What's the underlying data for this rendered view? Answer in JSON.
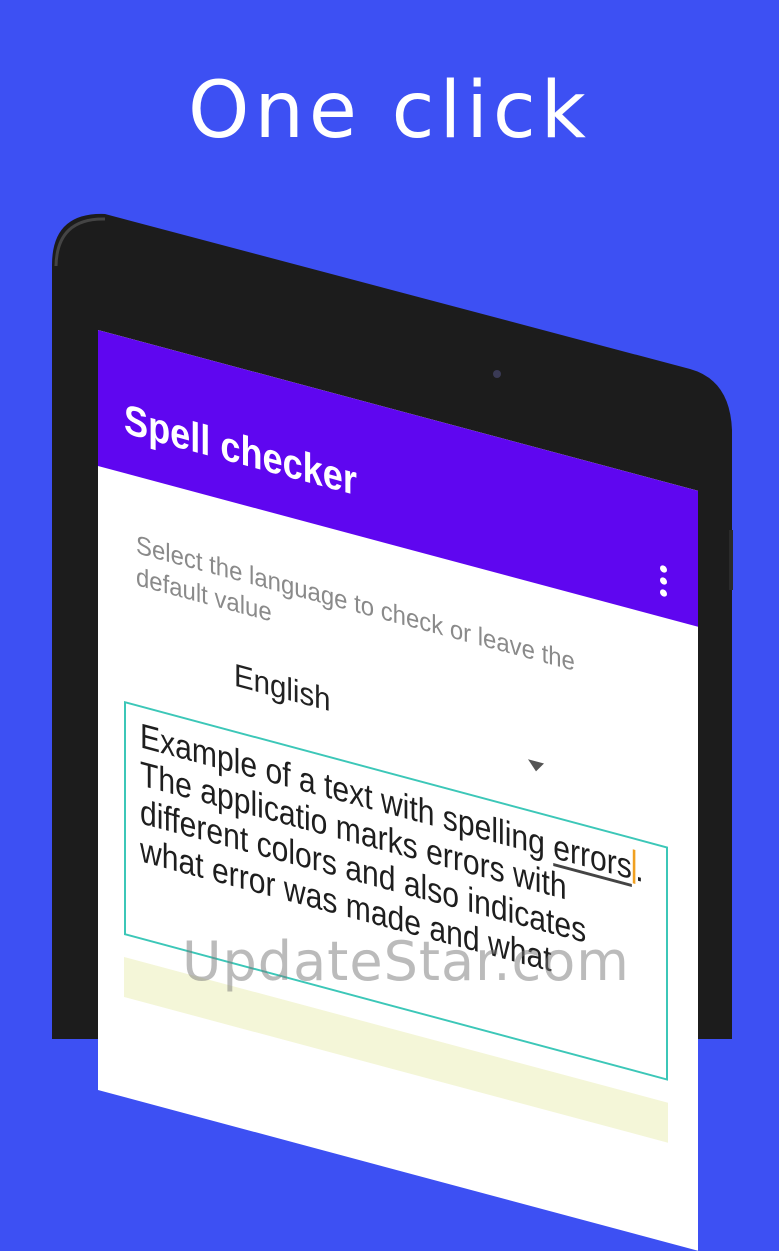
{
  "promo": {
    "headline": "One click"
  },
  "app": {
    "title": "Spell checker",
    "menu_icon": "more-vert-icon",
    "accent_color": "#5f06f0",
    "background_color": "#3d50f3"
  },
  "language": {
    "hint": "Select the language to check or leave the default value",
    "selected": "English"
  },
  "editor": {
    "line1_start": "Example of a text with spelling ",
    "line1_error": "errors",
    "line1_end": ".",
    "line2": "The applicatio marks errors with",
    "line3": "different colors and also indicates",
    "line4": "what error was made and what"
  },
  "watermark": "UpdateStar.com"
}
